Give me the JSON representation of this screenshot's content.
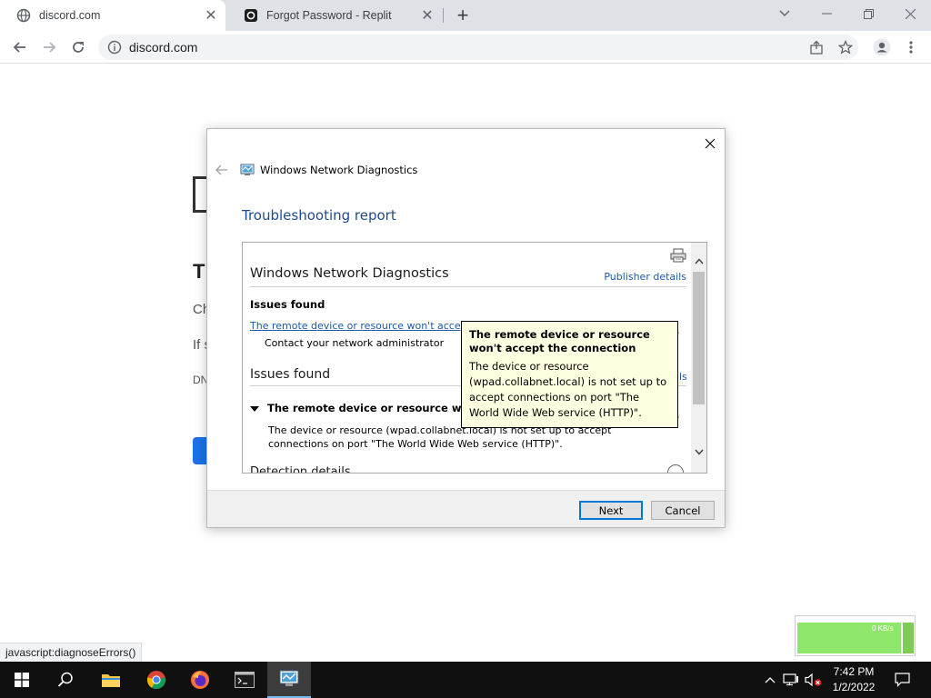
{
  "browser": {
    "tabs": [
      {
        "title": "discord.com",
        "active": true
      },
      {
        "title": "Forgot Password - Replit",
        "active": false
      }
    ],
    "address": "discord.com",
    "status_text": "javascript:diagnoseErrors()"
  },
  "background_page": {
    "heading_fragment": "T",
    "line1_fragment": "Ch",
    "line2_fragment": "If s",
    "line3_fragment": "DN"
  },
  "dialog": {
    "app_title": "Windows Network Diagnostics",
    "heading": "Troubleshooting report",
    "report": {
      "title": "Windows Network Diagnostics",
      "publisher_link": "Publisher details",
      "issues_found_label": "Issues found",
      "issue_link": "The remote device or resource won't accept",
      "contact": "Contact your network administrator",
      "issues_section_title": "Issues found",
      "detail_title": "The remote device or resource won't",
      "detail_body": "The device or resource (wpad.collabnet.local) is not set up to accept connections on port \"The World Wide Web service (HTTP)\".",
      "detection_title": "Detection details"
    },
    "tooltip": {
      "title": "The remote device or resource won't accept the connection",
      "body": "The device or resource (wpad.collabnet.local) is not set up to accept connections on port \"The World Wide Web service (HTTP)\"."
    },
    "buttons": {
      "next": "Next",
      "cancel": "Cancel"
    }
  },
  "net_widget": {
    "rate": "0 KB/s"
  },
  "taskbar": {
    "time": "7:42 PM",
    "date": "1/2/2022"
  }
}
